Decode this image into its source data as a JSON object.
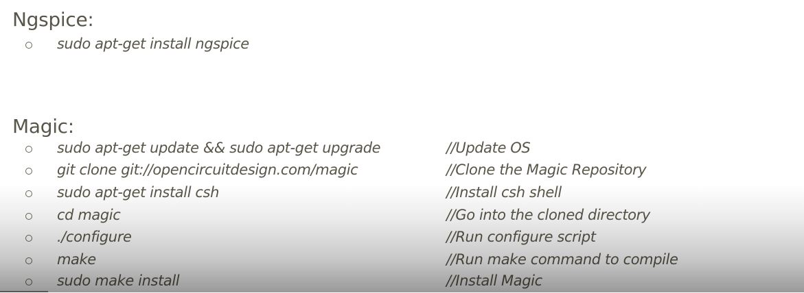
{
  "sections": [
    {
      "heading": "Ngspice:",
      "items": [
        {
          "command": "sudo apt-get install ngspice",
          "comment": ""
        }
      ]
    },
    {
      "heading": "Magic:",
      "items": [
        {
          "command": "sudo apt-get update && sudo apt-get upgrade",
          "comment": "//Update OS"
        },
        {
          "command": "git clone git://opencircuitdesign.com/magic",
          "comment": "//Clone the Magic Repository"
        },
        {
          "command": "sudo apt-get install csh",
          "comment": "//Install csh shell"
        },
        {
          "command": "cd magic",
          "comment": "//Go into the cloned directory"
        },
        {
          "command": "./configure",
          "comment": "//Run configure script"
        },
        {
          "command": "make",
          "comment": "//Run make command to compile"
        },
        {
          "command": "sudo make install",
          "comment": "//Install Magic"
        }
      ]
    }
  ]
}
